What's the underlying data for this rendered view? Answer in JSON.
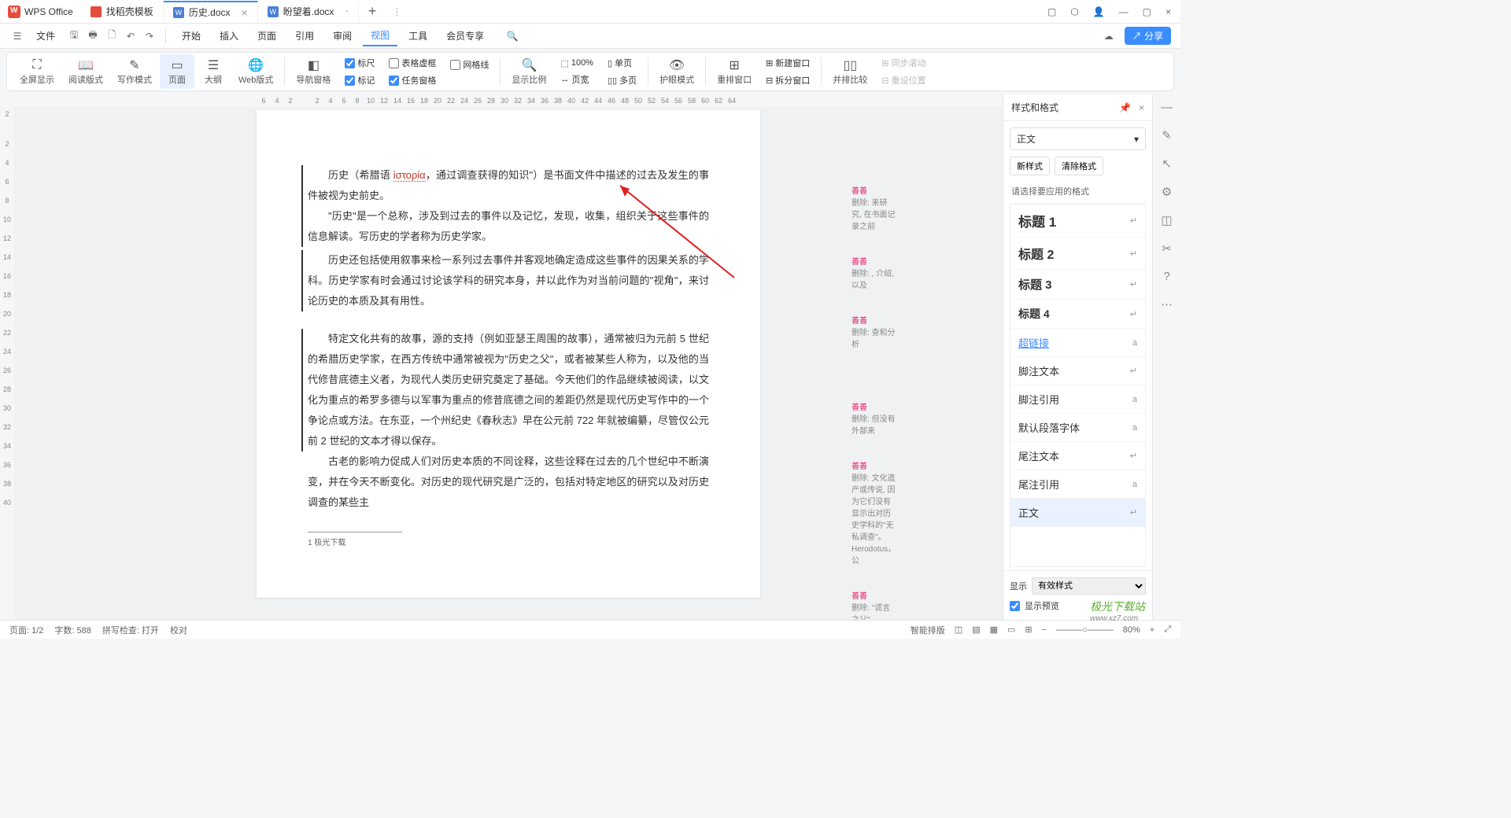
{
  "app": {
    "name": "WPS Office"
  },
  "tabs": [
    {
      "label": "找稻壳模板",
      "type": "red"
    },
    {
      "label": "历史.docx",
      "type": "blue",
      "active": true
    },
    {
      "label": "盼望着.docx",
      "type": "blue"
    }
  ],
  "menubar": {
    "file": "文件",
    "items": [
      "开始",
      "插入",
      "页面",
      "引用",
      "审阅",
      "视图",
      "工具",
      "会员专享"
    ],
    "active": "视图"
  },
  "shareBtn": "分享",
  "ribbon": {
    "fullscreen": "全屏显示",
    "readmode": "阅读版式",
    "writemode": "写作模式",
    "pagemode": "页面",
    "outline": "大纲",
    "webmode": "Web版式",
    "navpane": "导航窗格",
    "ruler": "标尺",
    "marker": "标记",
    "tableborder": "表格虚框",
    "gridlines": "网格线",
    "taskpane": "任务窗格",
    "zoomratio": "显示比例",
    "pagewidth": "页宽",
    "pct100": "100%",
    "singlepage": "单页",
    "multipage": "多页",
    "eyemode": "护眼模式",
    "arrangewin": "重排窗口",
    "newwin": "新建窗口",
    "splitwin": "拆分窗口",
    "compare": "并排比较",
    "syncscroll": "同步滚动",
    "resetpos": "重设位置"
  },
  "hruler": [
    "6",
    "4",
    "2",
    "",
    "2",
    "4",
    "6",
    "8",
    "10",
    "12",
    "14",
    "16",
    "18",
    "20",
    "22",
    "24",
    "26",
    "28",
    "30",
    "32",
    "34",
    "36",
    "38",
    "40",
    "42",
    "44",
    "46",
    "48",
    "50",
    "52",
    "54",
    "56",
    "58",
    "60",
    "62",
    "64"
  ],
  "vruler": [
    "2",
    "",
    "2",
    "4",
    "6",
    "8",
    "10",
    "12",
    "14",
    "16",
    "18",
    "20",
    "22",
    "24",
    "26",
    "28",
    "30",
    "32",
    "34",
    "36",
    "38",
    "40"
  ],
  "document": {
    "p1a": "历史（希腊语 ",
    "p1greek": "ἱστορία",
    "p1b": "，通过调查获得的知识\"）是书面文件中描述的过去及发生的事件被视为史前史。",
    "p2": "\"历史\"是一个总称，涉及到过去的事件以及记忆，发现，收集，组织关于这些事件的信息解读。写历史的学者称为历史学家。",
    "p3": "历史还包括使用叙事来检一系列过去事件并客观地确定造成这些事件的因果关系的学科。历史学家有时会通过讨论该学科的研究本身，并以此作为对当前问题的\"视角\"，来讨论历史的本质及其有用性。",
    "p4": "特定文化共有的故事，源的支持（例如亚瑟王周围的故事），通常被归为元前 5 世纪的希腊历史学家，在西方传统中通常被视为\"历史之父\"，或者被某些人称为，以及他的当代修昔底德主义者，为现代人类历史研究奠定了基础。今天他们的作品继续被阅读，以文化为重点的希罗多德与以军事为重点的修昔底德之间的差距仍然是现代历史写作中的一个争论点或方法。在东亚，一个州纪史《春秋志》早在公元前 722 年就被编纂，尽管仅公元前 2 世纪的文本才得以保存。",
    "p5": "古老的影响力促成人们对历史本质的不同诠释，这些诠释在过去的几个世纪中不断演变，并在今天不断变化。对历史的现代研究是广泛的，包括对特定地区的研究以及对历史调查的某些主",
    "footnote": "1 极光下载"
  },
  "revisions": [
    {
      "tag": "善善",
      "text": "删除: 来研究, 在书面记录之前"
    },
    {
      "tag": "善善",
      "text": "删除: , 介绍, 以及"
    },
    {
      "tag": "善善",
      "text": "删除: 查和分析"
    },
    {
      "tag": "善善",
      "text": "删除: 但没有外部来"
    },
    {
      "tag": "善善",
      "text": "删除: 文化遗产或传说, 因为它们没有显示出对历史学科的\"无私调查\"。Herodotus，公"
    },
    {
      "tag": "善善",
      "text": "删除: \"谎言之父\""
    }
  ],
  "stylePanel": {
    "title": "样式和格式",
    "current": "正文",
    "newStyle": "新样式",
    "clearFormat": "清除格式",
    "hint": "请选择要应用的格式",
    "styles": [
      {
        "name": "标题 1",
        "cls": "h1",
        "mark": "↵"
      },
      {
        "name": "标题 2",
        "cls": "h2",
        "mark": "↵"
      },
      {
        "name": "标题 3",
        "cls": "h3",
        "mark": "↵"
      },
      {
        "name": "标题 4",
        "cls": "h4",
        "mark": "↵"
      },
      {
        "name": "超链接",
        "cls": "link",
        "mark": "a"
      },
      {
        "name": "脚注文本",
        "cls": "",
        "mark": "↵"
      },
      {
        "name": "脚注引用",
        "cls": "",
        "mark": "a"
      },
      {
        "name": "默认段落字体",
        "cls": "",
        "mark": "a"
      },
      {
        "name": "尾注文本",
        "cls": "",
        "mark": "↵"
      },
      {
        "name": "尾注引用",
        "cls": "",
        "mark": "a"
      },
      {
        "name": "正文",
        "cls": "",
        "mark": "↵",
        "selected": true
      }
    ],
    "showLabel": "显示",
    "showValue": "有效样式",
    "previewLabel": "显示预览"
  },
  "statusbar": {
    "page": "页面: 1/2",
    "words": "字数: 588",
    "spell": "拼写检查: 打开",
    "proof": "校对",
    "smartLayout": "智能排版",
    "zoom": "80%"
  },
  "watermark": {
    "main": "极光下载站",
    "sub": "www.xz7.com"
  }
}
